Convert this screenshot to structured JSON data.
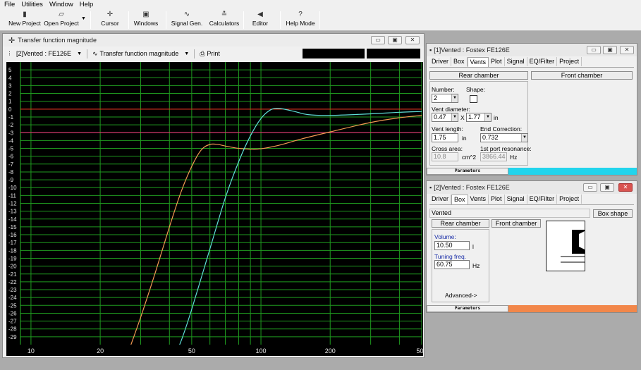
{
  "menu": [
    "File",
    "Utilities",
    "Window",
    "Help"
  ],
  "toolbar": [
    {
      "label": "New Project",
      "icon": "document-icon",
      "glyph": "▮"
    },
    {
      "label": "Open Project",
      "icon": "folder-open-icon",
      "glyph": "▱"
    },
    {
      "label": "Cursor",
      "icon": "crosshair-icon",
      "glyph": "✛"
    },
    {
      "label": "Windows",
      "icon": "windows-icon",
      "glyph": "▣"
    },
    {
      "label": "Signal Gen.",
      "icon": "sine-wave-icon",
      "glyph": "∿"
    },
    {
      "label": "Calculators",
      "icon": "calculator-icon",
      "glyph": "≛"
    },
    {
      "label": "Editor",
      "icon": "speaker-icon",
      "glyph": "◀"
    },
    {
      "label": "Help Mode",
      "icon": "question-icon",
      "glyph": "?"
    }
  ],
  "graph": {
    "title": "Transfer function magnitude",
    "driver_select": "[2]Vented : FE126E",
    "type_select": "Transfer function magnitude",
    "print_label": "Print"
  },
  "chart_data": {
    "type": "line",
    "x_scale": "log",
    "xlim": [
      9,
      500
    ],
    "ylim": [
      -30,
      6
    ],
    "x_ticks": [
      "10",
      "20",
      "50",
      "100",
      "200",
      "500"
    ],
    "y_ticks": [
      "5",
      "4",
      "3",
      "2",
      "1",
      "0",
      "-1",
      "-2",
      "-3",
      "-4",
      "-5",
      "-6",
      "-7",
      "-8",
      "-9",
      "-10",
      "-11",
      "-12",
      "-13",
      "-14",
      "-15",
      "-16",
      "-17",
      "-18",
      "-19",
      "-20",
      "-21",
      "-22",
      "-23",
      "-24",
      "-25",
      "-26",
      "-27",
      "-28",
      "-29"
    ],
    "grid": true,
    "reference_lines": [
      {
        "y": 0,
        "color": "#ff2020"
      },
      {
        "y": -3,
        "color": "#ff2080"
      }
    ],
    "series": [
      {
        "color": "#f39a52",
        "x": [
          25,
          30,
          35,
          40,
          45,
          50,
          55,
          60,
          65,
          70,
          80,
          90,
          100,
          120,
          150,
          200,
          300,
          400,
          500
        ],
        "y": [
          -33,
          -26.5,
          -20.5,
          -15,
          -10.5,
          -7.3,
          -5.2,
          -4.5,
          -4.5,
          -4.7,
          -5.0,
          -5.1,
          -5.05,
          -4.6,
          -3.8,
          -2.9,
          -1.7,
          -1.1,
          -0.8
        ]
      },
      {
        "color": "#5fe0d8",
        "x": [
          40,
          45,
          50,
          60,
          70,
          80,
          90,
          100,
          110,
          120,
          140,
          160,
          200,
          300,
          400,
          500
        ],
        "y": [
          -33,
          -29.5,
          -25.5,
          -17.8,
          -11.3,
          -6.7,
          -3.4,
          -1.2,
          -0.1,
          0.1,
          -0.3,
          -0.7,
          -0.8,
          -0.6,
          -0.4,
          -0.3
        ]
      }
    ]
  },
  "vent_window": {
    "title": "[1]Vented : Fostex  FE126E",
    "tabs": [
      "Driver",
      "Box",
      "Vents",
      "Plot",
      "Signal",
      "EQ/Filter",
      "Project"
    ],
    "active_tab": "Vents",
    "rear_chamber": "Rear chamber",
    "front_chamber": "Front chamber",
    "number_label": "Number:",
    "number_value": "2",
    "shape_label": "Shape:",
    "vent_diameter_label": "Vent diameter:",
    "diameter_a": "0.47",
    "times": "X",
    "diameter_b": "1.77",
    "unit_in": "in",
    "vent_length_label": "Vent length:",
    "vent_length_value": "1.75",
    "end_correction_label": "End Correction:",
    "end_correction_value": "0.732",
    "cross_area_label": "Cross area:",
    "cross_area_value": "10.8",
    "cross_area_unit": "cm^2",
    "port_resonance_label": "1st port resonance:",
    "port_resonance_value": "3866.44",
    "port_resonance_unit": "Hz",
    "status_label": "Parameters",
    "status_color": "#22d4ec"
  },
  "box_window": {
    "title": "[2]Vented : Fostex  FE126E",
    "tabs": [
      "Driver",
      "Box",
      "Vents",
      "Plot",
      "Signal",
      "EQ/Filter",
      "Project"
    ],
    "active_tab": "Box",
    "box_type": "Vented",
    "box_shape_button": "Box shape",
    "rear_chamber": "Rear chamber",
    "front_chamber": "Front chamber",
    "volume_label": "Volume:",
    "volume_value": "10.50",
    "volume_unit": "l",
    "tuning_label": "Tuning freq.",
    "tuning_value": "60.75",
    "tuning_unit": "Hz",
    "advanced": "Advanced->",
    "status_label": "Parameters",
    "status_color": "#f2874a"
  }
}
